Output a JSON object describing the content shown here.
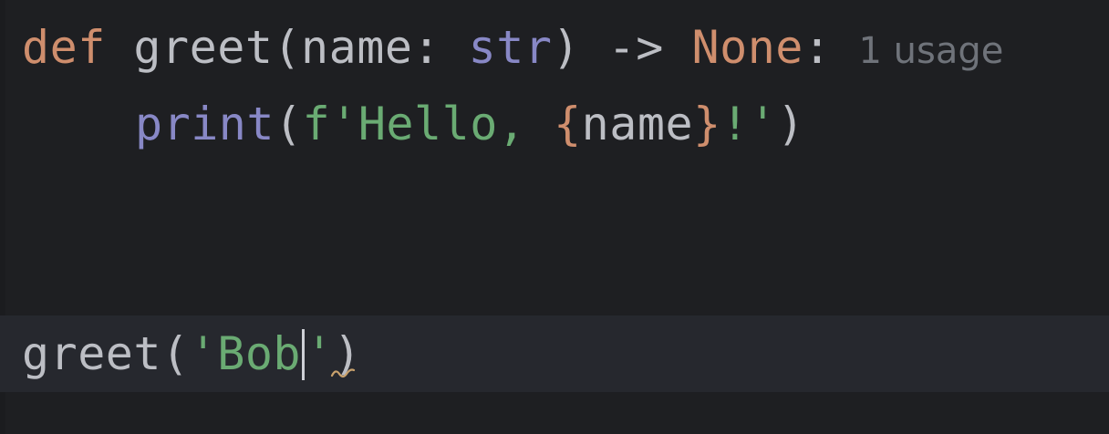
{
  "editor": {
    "lines": [
      {
        "tokens": [
          {
            "text": "def",
            "role": "keyword"
          },
          {
            "text": " ",
            "role": "space"
          },
          {
            "text": "greet",
            "role": "function"
          },
          {
            "text": "(name: ",
            "role": "plain"
          },
          {
            "text": "str",
            "role": "builtin"
          },
          {
            "text": ") -> ",
            "role": "plain"
          },
          {
            "text": "None",
            "role": "keyword"
          },
          {
            "text": ":",
            "role": "plain"
          }
        ],
        "inlay_hint": "1 usage"
      },
      {
        "tokens": [
          {
            "text": "print",
            "role": "builtin"
          },
          {
            "text": "(",
            "role": "plain"
          },
          {
            "text": "f'Hello, ",
            "role": "string"
          },
          {
            "text": "{",
            "role": "brace"
          },
          {
            "text": "name",
            "role": "plain"
          },
          {
            "text": "}",
            "role": "brace"
          },
          {
            "text": "!'",
            "role": "string"
          },
          {
            "text": ")",
            "role": "plain"
          }
        ]
      },
      {
        "tokens_before_caret": [
          {
            "text": "greet",
            "role": "plain"
          },
          {
            "text": "(",
            "role": "plain"
          },
          {
            "text": "'Bob",
            "role": "string"
          }
        ],
        "tokens_after_caret": [
          {
            "text": "'",
            "role": "string"
          },
          {
            "text": ")",
            "role": "plain"
          }
        ]
      }
    ]
  },
  "colors": {
    "background": "#1e1f22",
    "current_line": "#26282e",
    "keyword": "#cf8e6d",
    "builtin": "#8888c6",
    "string": "#6aab73",
    "text": "#bcbec4",
    "inlay_hint": "#6f737a",
    "warning_squiggle": "#c9a26d"
  }
}
